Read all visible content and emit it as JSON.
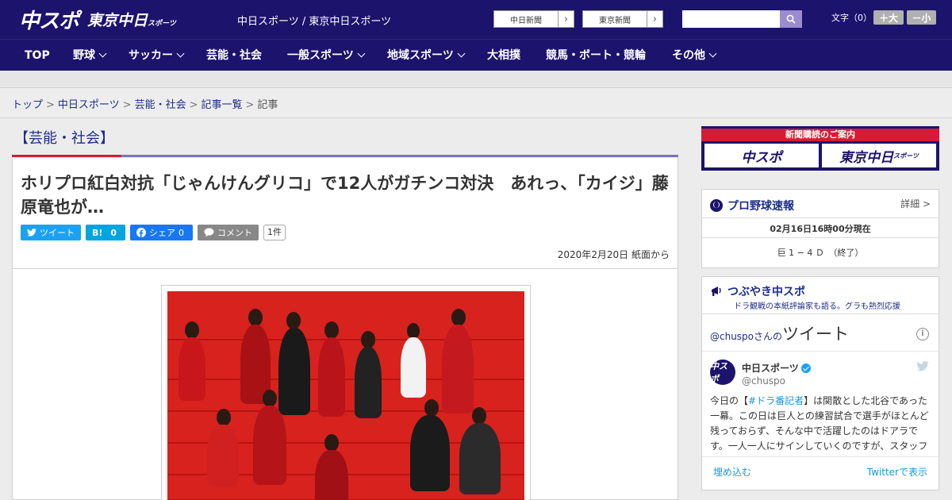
{
  "header": {
    "logo_chuspo": "中スポ",
    "logo_tokyo": "東京中日",
    "logo_tokyo_small": "スポーツ",
    "site_links": "中日スポーツ / 東京中日スポーツ",
    "ext_links": [
      {
        "label": "中日新聞"
      },
      {
        "label": "東京新聞"
      }
    ],
    "search_placeholder": "",
    "fontsize_label": "文字（0）",
    "font_up": "＋大",
    "font_down": "－小"
  },
  "nav": {
    "items": [
      {
        "label": "TOP",
        "dropdown": false
      },
      {
        "label": "野球",
        "dropdown": true
      },
      {
        "label": "サッカー",
        "dropdown": true
      },
      {
        "label": "芸能・社会",
        "dropdown": false
      },
      {
        "label": "一般スポーツ",
        "dropdown": true
      },
      {
        "label": "地域スポーツ",
        "dropdown": true
      },
      {
        "label": "大相撲",
        "dropdown": false
      },
      {
        "label": "競馬・ボート・競輪",
        "dropdown": false
      },
      {
        "label": "その他",
        "dropdown": true
      }
    ]
  },
  "breadcrumb": {
    "items": [
      "トップ",
      "中日スポーツ",
      "芸能・社会",
      "記事一覧"
    ],
    "current": "記事",
    "separator": ">"
  },
  "article": {
    "category": "【芸能・社会】",
    "headline": "ホリプロ紅白対抗「じゃんけんグリコ」で12人がガチンコ対決　あれっ、「カイジ」藤原竜也が…",
    "share": {
      "tweet_label": "ツイート",
      "hatena_label": "B!",
      "hatena_count": "0",
      "facebook_label": "シェア",
      "facebook_count": "0",
      "comment_label": "コメント",
      "comment_count": "1件"
    },
    "date": "2020年2月20日 紙面から"
  },
  "sidebar": {
    "banner": {
      "title": "新聞購読のご案内",
      "chuspo": "中スポ",
      "tokyo": "東京中日",
      "tokyo_small": "スポーツ"
    },
    "baseball": {
      "title": "プロ野球速報",
      "detail": "詳細 >",
      "timestamp": "02月16日16時00分現在",
      "score": "巨 1 − 4 Ｄ　（終了）"
    },
    "tweets": {
      "title": "つぶやき中スポ",
      "subtitle": "ドラ観戦の本紙評論家も語る。グラも熱烈応援",
      "handle_prefix": "@chuspo",
      "handle_suffix": "さんの",
      "heading": "ツイート",
      "user_name": "中日スポーツ",
      "user_handle": "@chuspo",
      "avatar_text": "中スポ",
      "text_before": "今日の【",
      "hashtag": "#ドラ番記者",
      "text_after": "】は関散とした北谷であった一幕。この日は巨人との練習試合で選手がほとんど残っておらず、そんな中で活躍したのはドアラです。一人一人にサインしていくのですが、スタッフ",
      "embed_label": "埋め込む",
      "view_label": "Twitterで表示"
    }
  },
  "colors": {
    "brand_navy": "#1c136d",
    "accent_red": "#d61b3a",
    "twitter_blue": "#1b95e0",
    "hatena_blue": "#00a4de",
    "facebook_blue": "#1877f2"
  }
}
